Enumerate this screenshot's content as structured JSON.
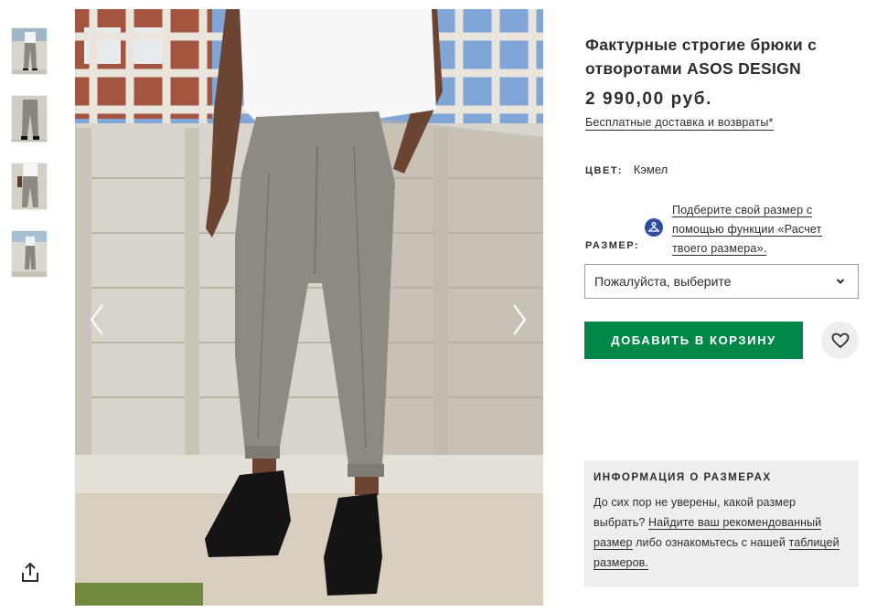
{
  "product": {
    "title": "Фактурные строгие брюки с отворотами ASOS DESIGN",
    "price": "2 990,00 руб.",
    "delivery_link": "Бесплатные доставка и возвраты*"
  },
  "color": {
    "label": "ЦВЕТ:",
    "value": "Кэмел"
  },
  "size": {
    "label": "РАЗМЕР:",
    "fit_link": "Подберите свой размер с помощью функции «Расчет твоего размера».",
    "select_value": "Пожалуйста, выберите"
  },
  "actions": {
    "add_to_cart": "ДОБАВИТЬ В КОРЗИНУ"
  },
  "size_info": {
    "heading": "ИНФОРМАЦИЯ О РАЗМЕРАХ",
    "text_1": "До сих пор не уверены, какой размер выбрать? ",
    "link_1": "Найдите ваш рекомендованный размер",
    "text_2": " либо ознакомьтесь с нашей ",
    "link_2": "таблицей размеров."
  },
  "icons": {
    "share": "share-icon",
    "arrow_left": "chevron-left-icon",
    "arrow_right": "chevron-right-icon",
    "caret": "chevron-down-icon",
    "wishlist": "heart-icon",
    "fit_assistant": "hanger-icon"
  },
  "colors": {
    "accent_green": "#018849",
    "fit_icon_blue": "#2c4fa3",
    "panel_grey": "#eeeeee"
  }
}
